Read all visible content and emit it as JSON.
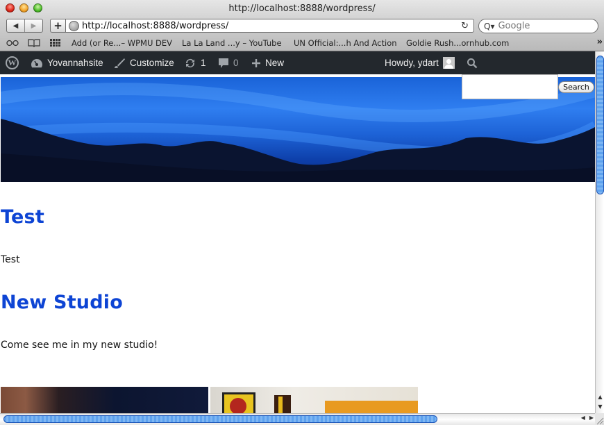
{
  "browser": {
    "window_title": "http://localhost:8888/wordpress/",
    "back_icon": "◀",
    "forward_icon": "▶",
    "add_icon": "+",
    "url": "http://localhost:8888/wordpress/",
    "reload_icon": "↻",
    "search_placeholder": "Google",
    "search_icon": "Q▾",
    "bookmarks_icons": {
      "reading_list": "👓",
      "bookmarks": "📖",
      "top_sites": "▦"
    },
    "bookmarks": [
      "Add (or Re...– WPMU DEV",
      "La La Land ...y – YouTube",
      "UN Official:...h And Action",
      "Goldie Rush...ornhub.com"
    ],
    "bookmarks_more": "»"
  },
  "adminbar": {
    "wp_logo": "W",
    "site_name": "Yovannahsite",
    "customize": "Customize",
    "updates_count": "1",
    "comments_count": "0",
    "new_label": "New",
    "howdy": "Howdy, ydart",
    "search_icon": "⌕"
  },
  "site": {
    "search_value": "",
    "search_button": "Search",
    "posts": [
      {
        "title": "Test",
        "body": "Test"
      },
      {
        "title": "New Studio",
        "body": "Come see me in my new studio!"
      }
    ]
  },
  "scrollbars": {
    "up_arrow": "▲",
    "down_arrow": "▼",
    "left_arrow": "◀",
    "right_arrow": "▶"
  }
}
